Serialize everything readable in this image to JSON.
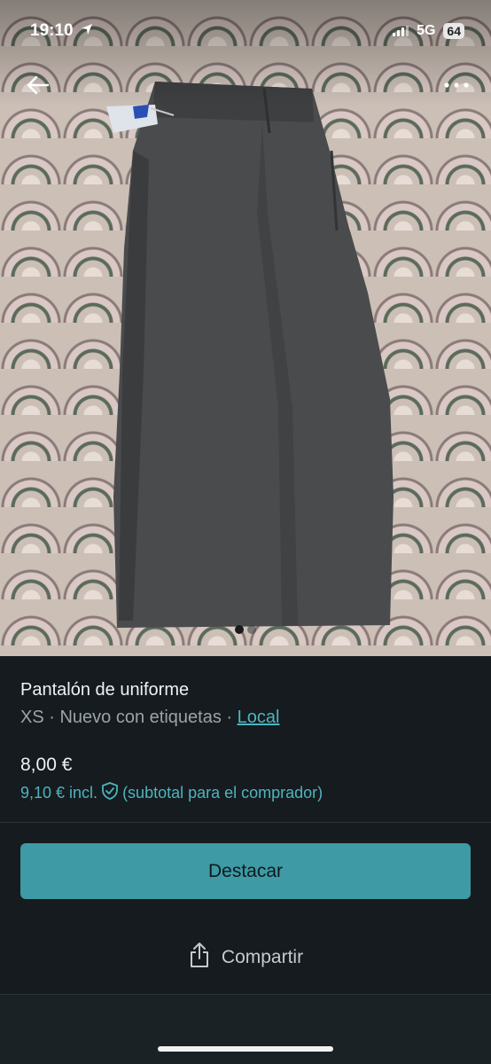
{
  "status_bar": {
    "time": "19:10",
    "network": "5G",
    "battery": "64"
  },
  "gallery": {
    "image_count": 2,
    "active_index": 0
  },
  "item": {
    "title": "Pantalón de uniforme",
    "size": "XS",
    "separator": "·",
    "condition": "Nuevo con etiquetas",
    "location_link": "Local",
    "price": "8,00 €",
    "buyer_price": "9,10 € incl.",
    "buyer_price_note": "(subtotal para el comprador)"
  },
  "actions": {
    "highlight_label": "Destacar",
    "share_label": "Compartir"
  },
  "colors": {
    "accent": "#3e9aa5",
    "link": "#4fb4bf",
    "background": "#151b1e"
  },
  "icons": [
    "back-arrow-icon",
    "more-options-icon",
    "location-arrow-icon",
    "shield-check-icon",
    "share-icon"
  ]
}
